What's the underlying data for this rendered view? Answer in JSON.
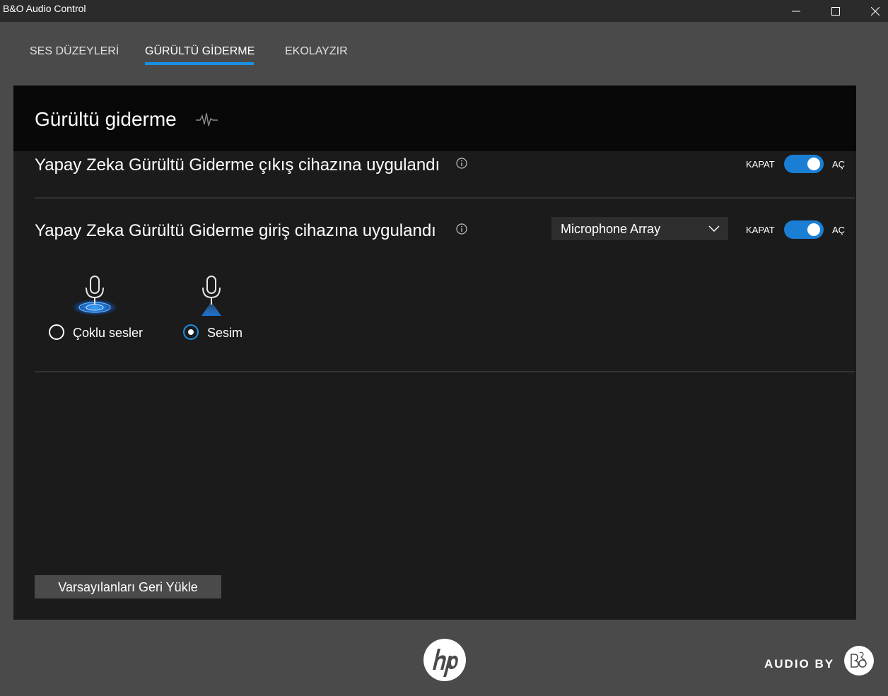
{
  "window": {
    "title": "B&O Audio Control",
    "controls": [
      "minimize-icon",
      "maximize-icon",
      "close-icon"
    ]
  },
  "tabs": [
    {
      "label": "SES DÜZEYLERİ",
      "active": false
    },
    {
      "label": "GÜRÜLTÜ GİDERME",
      "active": true
    },
    {
      "label": "EKOLAYZIR",
      "active": false
    }
  ],
  "panel": {
    "title": "Gürültü giderme",
    "title_icon": "waveform-icon",
    "output_row": {
      "label": "Yapay Zeka Gürültü Giderme çıkış cihazına uygulandı",
      "off_label": "KAPAT",
      "on_label": "AÇ",
      "enabled": true
    },
    "input_row": {
      "label": "Yapay Zeka Gürültü Giderme giriş cihazına uygulandı",
      "device": "Microphone Array",
      "off_label": "KAPAT",
      "on_label": "AÇ",
      "enabled": true
    },
    "modes": [
      {
        "label": "Çoklu sesler",
        "selected": false,
        "icon": "microphone-multi-icon"
      },
      {
        "label": "Sesim",
        "selected": true,
        "icon": "microphone-single-icon"
      }
    ],
    "restore_button": "Varsayılanları Geri Yükle"
  },
  "footer": {
    "hp_logo": "hp-logo",
    "audio_by": "AUDIO BY",
    "bo_logo": "bo-logo"
  },
  "colors": {
    "accent": "#1a8fe3",
    "toggle_on": "#1a7fd4",
    "window_bg": "#4a4a4a",
    "panel_bg": "#1b1b1b",
    "header_bg": "#080808"
  }
}
